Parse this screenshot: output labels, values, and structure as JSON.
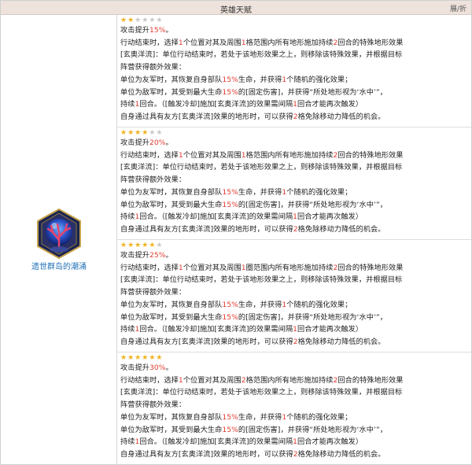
{
  "header": {
    "title": "英雄天赋",
    "toggle_label": "展/折"
  },
  "talent": {
    "name": "遗世群岛的潮涌",
    "icon": "coral-orb-icon"
  },
  "star_colors": {
    "on": "#f0b21e",
    "off": "#c8c8c8"
  },
  "levels": [
    {
      "stars": 2,
      "max_stars": 6,
      "l1": {
        "a": "攻击提升",
        "b": "15%",
        "c": "。"
      },
      "l2": {
        "a": "行动结束时，选择",
        "b": "1",
        "c": "个位置对其及周围",
        "d": "1",
        "e": "格范围内所有地形施加持续",
        "f": "2",
        "g": "回合的特殊地形效果"
      },
      "l3": "[玄奥洋流]：单位行动结束时，若处于该地形效果之上，则移除该特殊效果，并根据目标",
      "l4": "阵营获得额外效果：",
      "l5": {
        "a": "单位为友军时，其恢复自身部队",
        "b": "15%",
        "c": "生命，并获得",
        "d": "1",
        "e": "个随机的强化效果；"
      },
      "l6": {
        "a": "单位为敌军时，其受到最大生命",
        "b": "15%",
        "c": "的[固定伤害]，并获得“所处地形视为‘水中’”，"
      },
      "l7": {
        "a": "持续",
        "b": "1",
        "c": "回合。（[触发冷却]施加[玄奥洋流]的效果需间隔",
        "d": "1",
        "e": "回合才能再次触发）"
      },
      "l8": {
        "a": "自身通过具有友方[玄奥洋流]效果的地形时，可以获得",
        "b": "2",
        "c": "格免除移动力降低的机会。"
      }
    },
    {
      "stars": 4,
      "max_stars": 6,
      "l1": {
        "a": "攻击提升",
        "b": "20%",
        "c": "。"
      },
      "l2": {
        "a": "行动结束时，选择",
        "b": "1",
        "c": "个位置对其及周围",
        "d": "1",
        "e": "格范围内所有地形施加持续",
        "f": "2",
        "g": "回合的特殊地形效果"
      },
      "l3": "[玄奥洋流]：单位行动结束时，若处于该地形效果之上，则移除该特殊效果，并根据目标",
      "l4": "阵营获得额外效果：",
      "l5": {
        "a": "单位为友军时，其恢复自身部队",
        "b": "15%",
        "c": "生命，并获得",
        "d": "1",
        "e": "个随机的强化效果；"
      },
      "l6": {
        "a": "单位为敌军时，其受到最大生命",
        "b": "15%",
        "c": "的[固定伤害]，并获得“所处地形视为‘水中’”，"
      },
      "l7": {
        "a": "持续",
        "b": "1",
        "c": "回合。（[触发冷却]施加[玄奥洋流]的效果需间隔",
        "d": "1",
        "e": "回合才能再次触发）"
      },
      "l8": {
        "a": "自身通过具有友方[玄奥洋流]效果的地形时，可以获得",
        "b": "2",
        "c": "格免除移动力降低的机会。"
      }
    },
    {
      "stars": 5,
      "max_stars": 6,
      "l1": {
        "a": "攻击提升",
        "b": "25%",
        "c": "。"
      },
      "l2": {
        "a": "行动结束时，选择",
        "b": "1",
        "c": "个位置对其及周围",
        "d": "1",
        "e": "圈范围内所有地形施加持续",
        "f": "2",
        "g": "回合的特殊地形效果"
      },
      "l3": "[玄奥洋流]：单位行动结束时，若处于该地形效果之上，则移除该特殊效果，并根据目标",
      "l4": "阵营获得额外效果：",
      "l5": {
        "a": "单位为友军时，其恢复自身部队",
        "b": "15%",
        "c": "生命，并获得",
        "d": "1",
        "e": "个随机的强化效果；"
      },
      "l6": {
        "a": "单位为敌军时，其受到最大生命",
        "b": "15%",
        "c": "的[固定伤害]，并获得“所处地形视为‘水中’”，"
      },
      "l7": {
        "a": "持续",
        "b": "1",
        "c": "回合。（[触发冷却]施加[玄奥洋流]的效果需间隔",
        "d": "1",
        "e": "回合才能再次触发）"
      },
      "l8": {
        "a": "自身通过具有友方[玄奥洋流]效果的地形时，可以获得",
        "b": "2",
        "c": "格免除移动力降低的机会。"
      }
    },
    {
      "stars": 6,
      "max_stars": 6,
      "l1": {
        "a": "攻击提升",
        "b": "30%",
        "c": "。"
      },
      "l2": {
        "a": "行动结束时，选择",
        "b": "1",
        "c": "个位置对其及周围",
        "d": "2",
        "e": "格范围内所有地形施加持续",
        "f": "2",
        "g": "回合的特殊地形效果"
      },
      "l3": "[玄奥洋流]：单位行动结束时，若处于该地形效果之上，则移除该特殊效果，并根据目标",
      "l4": "阵营获得额外效果：",
      "l5": {
        "a": "单位为友军时，其恢复自身部队",
        "b": "15%",
        "c": "生命，并获得",
        "d": "1",
        "e": "个随机的强化效果；"
      },
      "l6": {
        "a": "单位为敌军时，其受到最大生命",
        "b": "15%",
        "c": "的[固定伤害]，并获得“所处地形视为‘水中’”，"
      },
      "l7": {
        "a": "持续",
        "b": "1",
        "c": "回合。（[触发冷却]施加[玄奥洋流]的效果需间隔",
        "d": "1",
        "e": "回合才能再次触发）"
      },
      "l8": {
        "a": "自身通过具有友方[玄奥洋流]效果的地形时，可以获得",
        "b": "2",
        "c": "格免除移动力降低的机会。"
      }
    }
  ]
}
